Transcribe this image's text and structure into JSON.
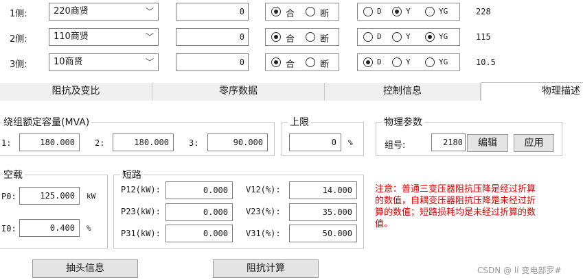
{
  "sides": [
    {
      "label": "1侧:",
      "voltage": "220商贤",
      "value": "0",
      "switch": {
        "close": "合",
        "open": "断",
        "selected": "close"
      },
      "winding": {
        "options": [
          "D",
          "Y",
          "YG"
        ],
        "selected": "Y"
      },
      "rated": "228"
    },
    {
      "label": "2侧:",
      "voltage": "110商贤",
      "value": "0",
      "switch": {
        "close": "合",
        "open": "断",
        "selected": "close"
      },
      "winding": {
        "options": [
          "D",
          "Y",
          "YG"
        ],
        "selected": "YG"
      },
      "rated": "115"
    },
    {
      "label": "3侧:",
      "voltage": "10商贤",
      "value": "0",
      "switch": {
        "close": "合",
        "open": "断",
        "selected": "close"
      },
      "winding": {
        "options": [
          "D",
          "Y",
          "YG"
        ],
        "selected": "D"
      },
      "rated": "10.5"
    }
  ],
  "tabs": [
    "阻抗及变比",
    "零序数据",
    "控制信息",
    "物理描述"
  ],
  "active_tab": "物理描述",
  "capacity": {
    "title": "绕组额定容量(MVA)",
    "labels": [
      "1:",
      "2:",
      "3:"
    ],
    "values": [
      "180.000",
      "180.000",
      "90.000"
    ]
  },
  "upper_limit": {
    "title": "上限",
    "value": "0",
    "unit": "%"
  },
  "physical_params": {
    "title": "物理参数",
    "group_label": "组号:",
    "group_value": "2180",
    "edit_label": "编辑",
    "apply_label": "应用"
  },
  "no_load": {
    "title": "空载",
    "p0_label": "P0:",
    "p0_value": "125.000",
    "p0_unit": "kW",
    "i0_label": "I0:",
    "i0_value": "0.400",
    "i0_unit": "%"
  },
  "short_circuit": {
    "title": "短路",
    "rows": [
      {
        "p_label": "P12(kW):",
        "p_value": "0.000",
        "v_label": "V12(%):",
        "v_value": "14.000"
      },
      {
        "p_label": "P23(kW):",
        "p_value": "0.000",
        "v_label": "V23(%):",
        "v_value": "35.000"
      },
      {
        "p_label": "P31(kW):",
        "p_value": "0.000",
        "v_label": "V31(%):",
        "v_value": "50.000"
      }
    ]
  },
  "note": [
    "注意：普通三变压器阻抗压降是经过折算",
    "的数值，自耦变压器阻抗压降是未经过折",
    "算的数值；短路损耗均是未经过折算的数",
    "值。"
  ],
  "buttons": {
    "tap_info": "抽头信息",
    "impedance_calc": "阻抗计算"
  },
  "watermark": "CSDN @ lí 变电部罗#",
  "colors": {
    "note": "#e00000",
    "tab_bg": "#f0f0f0",
    "button_bg": "#e4e4e4"
  }
}
